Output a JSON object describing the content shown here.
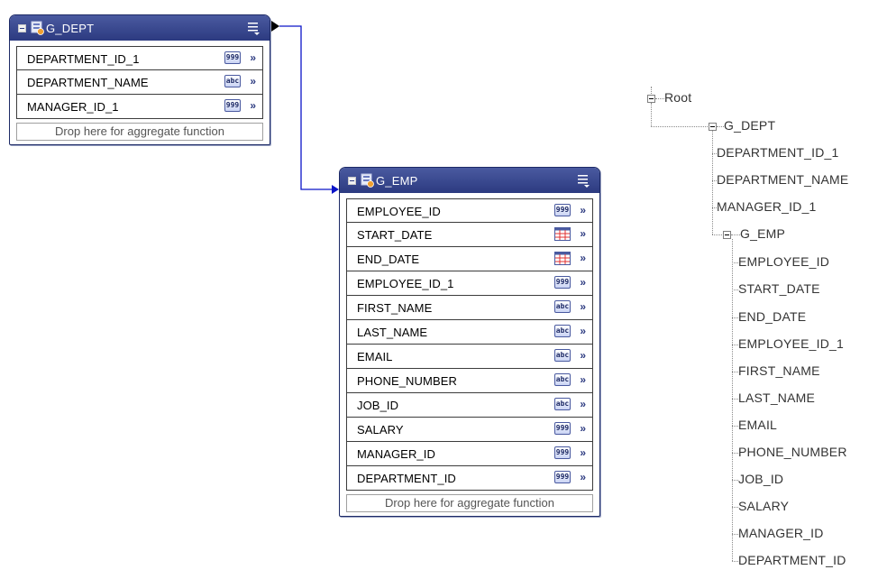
{
  "dept_group": {
    "title": "G_DEPT",
    "rows": [
      {
        "name": "DEPARTMENT_ID_1",
        "type": "999"
      },
      {
        "name": "DEPARTMENT_NAME",
        "type": "abc"
      },
      {
        "name": "MANAGER_ID_1",
        "type": "999"
      }
    ],
    "drop_text": "Drop here for aggregate function"
  },
  "emp_group": {
    "title": "G_EMP",
    "rows": [
      {
        "name": "EMPLOYEE_ID",
        "type": "999"
      },
      {
        "name": "START_DATE",
        "type": "date"
      },
      {
        "name": "END_DATE",
        "type": "date"
      },
      {
        "name": "EMPLOYEE_ID_1",
        "type": "999"
      },
      {
        "name": "FIRST_NAME",
        "type": "abc"
      },
      {
        "name": "LAST_NAME",
        "type": "abc"
      },
      {
        "name": "EMAIL",
        "type": "abc"
      },
      {
        "name": "PHONE_NUMBER",
        "type": "abc"
      },
      {
        "name": "JOB_ID",
        "type": "abc"
      },
      {
        "name": "SALARY",
        "type": "999"
      },
      {
        "name": "MANAGER_ID",
        "type": "999"
      },
      {
        "name": "DEPARTMENT_ID",
        "type": "999"
      }
    ],
    "drop_text": "Drop here for aggregate function"
  },
  "tree": {
    "root": "Root",
    "dept_node": "G_DEPT",
    "dept_fields": [
      "DEPARTMENT_ID_1",
      "DEPARTMENT_NAME",
      "MANAGER_ID_1"
    ],
    "emp_node": "G_EMP",
    "emp_fields": [
      "EMPLOYEE_ID",
      "START_DATE",
      "END_DATE",
      "EMPLOYEE_ID_1",
      "FIRST_NAME",
      "LAST_NAME",
      "EMAIL",
      "PHONE_NUMBER",
      "JOB_ID",
      "SALARY",
      "MANAGER_ID",
      "DEPARTMENT_ID"
    ]
  },
  "colors": {
    "header": "#2c3a80",
    "link": "#0a14c8"
  }
}
